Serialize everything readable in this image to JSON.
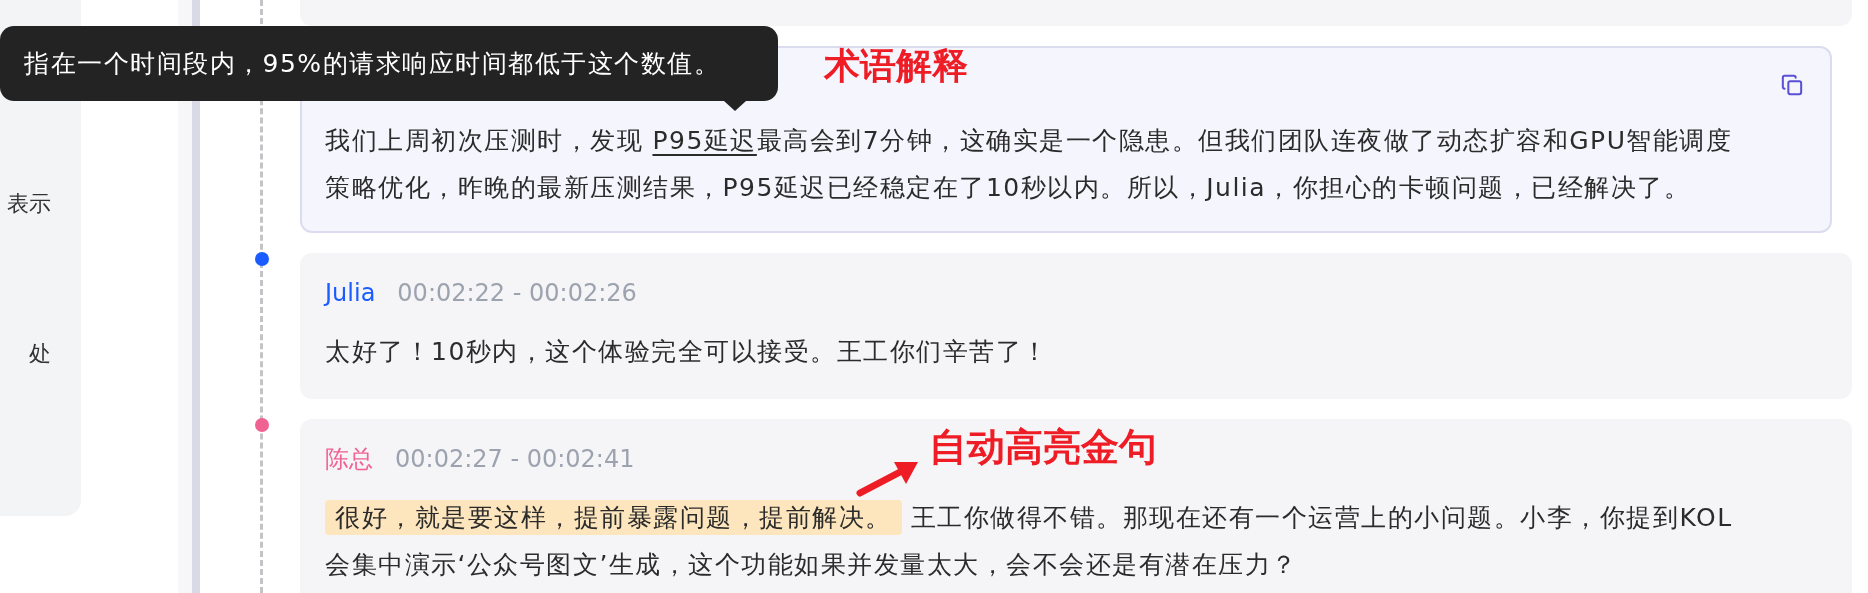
{
  "sidebar": {
    "items": [
      {
        "text": "表示"
      },
      {
        "text": "处"
      }
    ]
  },
  "tooltip": {
    "text": "指在一个时间段内，95%的请求响应时间都低于这个数值。"
  },
  "messages": [
    {
      "selected": true,
      "copyable": true,
      "annotation": {
        "kind": "label",
        "text": "术语解释"
      },
      "lines": [
        [
          {
            "kind": "plain",
            "text": "我们上周初次压测时，发现 "
          },
          {
            "kind": "term",
            "text": "P95延迟"
          },
          {
            "kind": "plain",
            "text": "最高会到7分钟，这确实是一个隐患。但我们团队连夜做了动态扩容和GPU智能调度"
          }
        ],
        [
          {
            "kind": "plain",
            "text": "策略优化，昨晚的最新压测结果，P95延迟已经稳定在了10秒以内。所以，Julia，你担心的卡顿问题，已经解决了。"
          }
        ]
      ]
    },
    {
      "selected": false,
      "speaker": "Julia",
      "time": "00:02:22 - 00:02:26",
      "color": "#1a5cff",
      "lines": [
        [
          {
            "kind": "plain",
            "text": "太好了！10秒内，这个体验完全可以接受。王工你们辛苦了！"
          }
        ]
      ]
    },
    {
      "selected": false,
      "speaker": "陈总",
      "time": "00:02:27 - 00:02:41",
      "color": "#f06292",
      "annotation": {
        "kind": "arrow",
        "text": "自动高亮金句"
      },
      "lines": [
        [
          {
            "kind": "highlight",
            "text": "很好，就是要这样，提前暴露问题，提前解决。"
          },
          {
            "kind": "plain",
            "text": " 王工你做得不错。那现在还有一个运营上的小问题。小李，你提到KOL"
          }
        ],
        [
          {
            "kind": "plain",
            "text": "会集中演示‘公众号图文’生成，这个功能如果并发量太大，会不会还是有潜在压力？"
          }
        ]
      ]
    }
  ]
}
